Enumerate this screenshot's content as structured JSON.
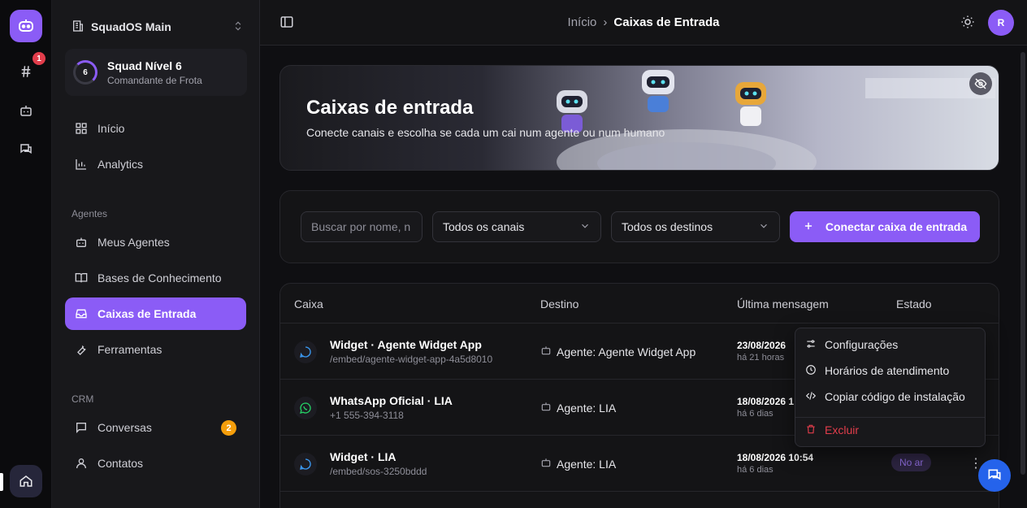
{
  "rail": {
    "notification_count": "1",
    "icons": [
      "robot-logo-icon",
      "hash-icon",
      "bot-icon",
      "chat-icon",
      "home-icon"
    ]
  },
  "sidebar": {
    "workspace": "SquadOS Main",
    "squad": {
      "level": "6",
      "title": "Squad Nível 6",
      "subtitle": "Comandante de Frota",
      "progress": 0.35
    },
    "nav_top": [
      {
        "label": "Início",
        "icon": "grid-icon"
      },
      {
        "label": "Analytics",
        "icon": "chart-icon"
      }
    ],
    "section_agents": "Agentes",
    "nav_agents": [
      {
        "label": "Meus Agentes",
        "icon": "bot-icon"
      },
      {
        "label": "Bases de Conhecimento",
        "icon": "book-icon"
      },
      {
        "label": "Caixas de Entrada",
        "icon": "inbox-icon",
        "active": true
      },
      {
        "label": "Ferramentas",
        "icon": "wrench-icon"
      }
    ],
    "section_crm": "CRM",
    "nav_crm": [
      {
        "label": "Conversas",
        "icon": "chat-icon",
        "badge": "2"
      },
      {
        "label": "Contatos",
        "icon": "user-icon"
      }
    ]
  },
  "topbar": {
    "breadcrumb": [
      "Início",
      "Caixas de Entrada"
    ],
    "avatar": "R"
  },
  "hero": {
    "title": "Caixas de entrada",
    "subtitle": "Conecte canais e escolha se cada um cai num agente ou num humano"
  },
  "filters": {
    "search_placeholder": "Buscar por nome, n",
    "channels": "Todos os canais",
    "destinations": "Todos os destinos",
    "cta": "Conectar caixa de entrada"
  },
  "table": {
    "headers": [
      "Caixa",
      "Destino",
      "Última mensagem",
      "Estado"
    ],
    "rows": [
      {
        "name": "Widget · Agente Widget App",
        "path": "/embed/agente-widget-app-4a5d8010",
        "dest": "Agente: Agente Widget App",
        "date": "23/08/2026",
        "rel": "há 21 horas",
        "channel": "widget"
      },
      {
        "name": "WhatsApp Oficial · LIA",
        "path": "+1 555-394-3118",
        "dest": "Agente: LIA",
        "date": "18/08/2026 1",
        "rel": "há 6 dias",
        "channel": "whatsapp"
      },
      {
        "name": "Widget · LIA",
        "path": "/embed/sos-3250bddd",
        "dest": "Agente: LIA",
        "date": "18/08/2026 10:54",
        "rel": "há 6 dias",
        "channel": "widget",
        "status": "No ar"
      }
    ]
  },
  "menu": {
    "items": [
      "Configurações",
      "Horários de atendimento",
      "Copiar código de instalação"
    ],
    "danger": "Excluir"
  },
  "colors": {
    "accent": "#8b5cf6",
    "danger": "#e23d4b",
    "badge": "#f59e0b",
    "fab": "#2563eb"
  }
}
